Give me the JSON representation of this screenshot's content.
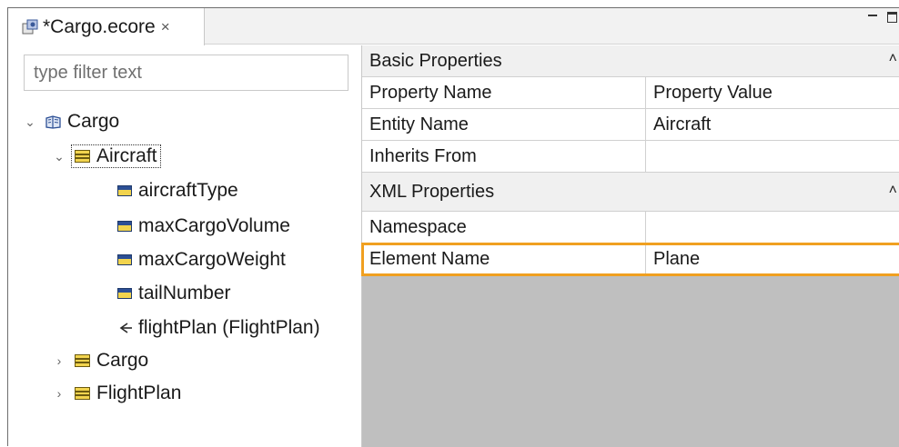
{
  "tab": {
    "title": "*Cargo.ecore",
    "close_glyph": "×",
    "icon": "ecore-file-icon"
  },
  "filter": {
    "placeholder": "type filter text",
    "value": ""
  },
  "tree": {
    "root": {
      "label": "Cargo",
      "icon": "package-icon",
      "expanded": true
    },
    "aircraft": {
      "label": "Aircraft",
      "icon": "eclass-icon",
      "expanded": true,
      "selected": true
    },
    "attributes": [
      {
        "label": "aircraftType",
        "icon": "eattribute-icon"
      },
      {
        "label": "maxCargoVolume",
        "icon": "eattribute-icon"
      },
      {
        "label": "maxCargoWeight",
        "icon": "eattribute-icon"
      },
      {
        "label": "tailNumber",
        "icon": "eattribute-icon"
      }
    ],
    "reference": {
      "label": "flightPlan (FlightPlan)",
      "icon": "ereference-icon"
    },
    "classes": [
      {
        "label": "Cargo",
        "icon": "eclass-icon",
        "expanded": false
      },
      {
        "label": "FlightPlan",
        "icon": "eclass-icon",
        "expanded": false
      }
    ]
  },
  "properties": {
    "basic": {
      "header": "Basic Properties",
      "col_name": "Property Name",
      "col_value": "Property Value",
      "rows": [
        {
          "name": "Entity Name",
          "value": "Aircraft"
        },
        {
          "name": "Inherits From",
          "value": ""
        }
      ]
    },
    "xml": {
      "header": "XML Properties",
      "rows": [
        {
          "name": "Namespace",
          "value": ""
        },
        {
          "name": "Element Name",
          "value": "Plane",
          "highlighted": true
        }
      ]
    },
    "collapse_glyph": "˄"
  },
  "colors": {
    "highlight": "#f0a020",
    "empty_area": "#bfbfbf"
  }
}
